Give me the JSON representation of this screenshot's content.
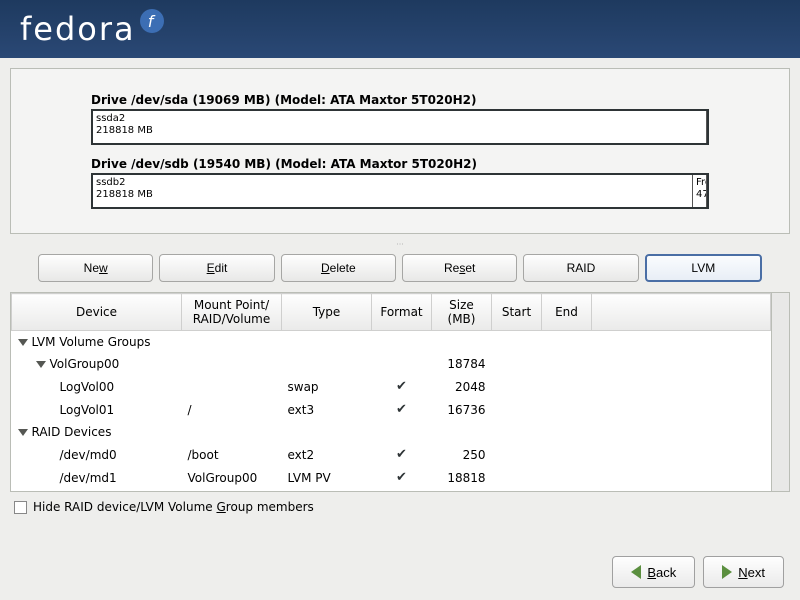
{
  "logo": "fedora",
  "drives": [
    {
      "title": "Drive /dev/sda (19069 MB) (Model: ATA Maxtor 5T020H2)",
      "parts": [
        {
          "name": "ssda2",
          "size": "218818 MB",
          "cls": "big"
        }
      ]
    },
    {
      "title": "Drive /dev/sdb (19540 MB) (Model: ATA Maxtor 5T020H2)",
      "parts": [
        {
          "name": "ssdb2",
          "size": "218818 MB",
          "cls": "big"
        },
        {
          "name": "Fre",
          "size": "47",
          "cls": "small"
        }
      ]
    }
  ],
  "buttons": {
    "new": "New",
    "edit": "Edit",
    "delete": "Delete",
    "reset": "Reset",
    "raid": "RAID",
    "lvm": "LVM"
  },
  "headers": {
    "device": "Device",
    "mount": "Mount Point/\nRAID/Volume",
    "type": "Type",
    "format": "Format",
    "size": "Size\n(MB)",
    "start": "Start",
    "end": "End"
  },
  "rows": [
    {
      "kind": "group",
      "indent": 0,
      "device": "LVM Volume Groups"
    },
    {
      "kind": "group",
      "indent": 1,
      "device": "VolGroup00",
      "size": "18784"
    },
    {
      "kind": "item",
      "indent": 2,
      "device": "LogVol00",
      "mount": "",
      "type": "swap",
      "format": true,
      "size": "2048"
    },
    {
      "kind": "item",
      "indent": 2,
      "device": "LogVol01",
      "mount": "/",
      "type": "ext3",
      "format": true,
      "size": "16736"
    },
    {
      "kind": "group",
      "indent": 0,
      "device": "RAID Devices"
    },
    {
      "kind": "item",
      "indent": 2,
      "device": "/dev/md0",
      "mount": "/boot",
      "type": "ext2",
      "format": true,
      "size": "250"
    },
    {
      "kind": "item",
      "indent": 2,
      "device": "/dev/md1",
      "mount": "VolGroup00",
      "type": "LVM PV",
      "format": true,
      "size": "18818"
    }
  ],
  "hide_label": "Hide RAID device/LVM Volume Group members",
  "nav": {
    "back": "Back",
    "next": "Next"
  }
}
